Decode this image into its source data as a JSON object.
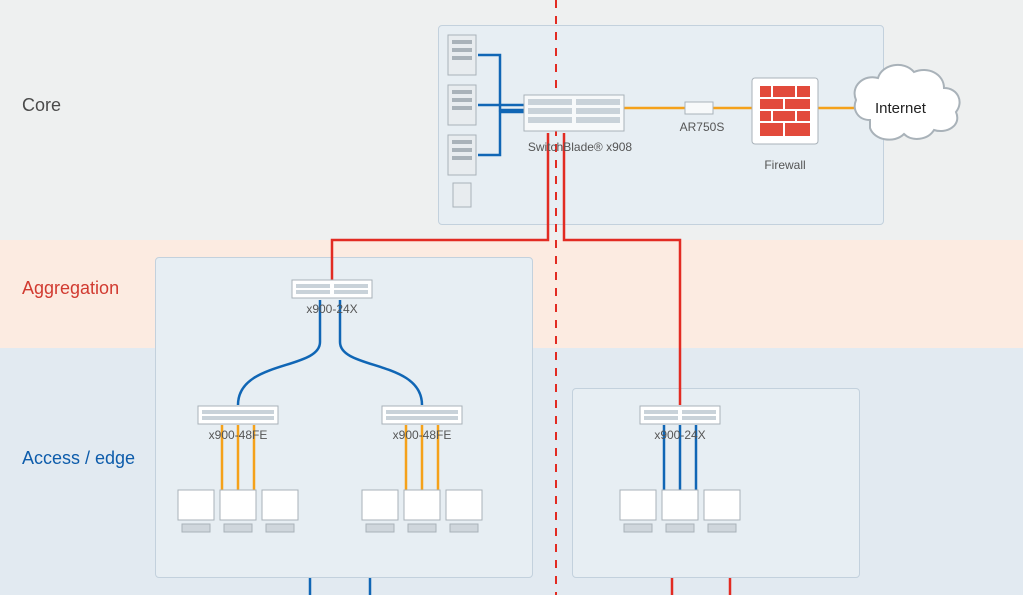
{
  "layers": {
    "core": "Core",
    "aggregation": "Aggregation",
    "access": "Access / edge"
  },
  "devices": {
    "switchblade": "SwitchBlade® x908",
    "ar750s": "AR750S",
    "firewall": "Firewall",
    "internet": "Internet",
    "x900_24x": "x900-24X",
    "x900_48fe": "x900-48FE"
  },
  "colors": {
    "blue": "#1066b5",
    "red": "#e22b22",
    "orange": "#f5a11a",
    "grey": "#a9b2b9"
  }
}
